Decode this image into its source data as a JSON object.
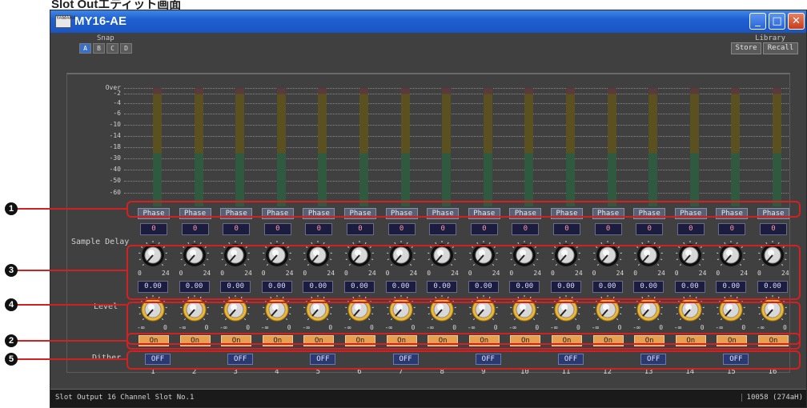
{
  "page_title": "Slot Outエディット画面",
  "window": {
    "title": "MY16-AE",
    "icon_label": "YAMAHA"
  },
  "window_controls": {
    "minimize": "_",
    "maximize": "□",
    "close": "✕"
  },
  "snap": {
    "label": "Snap",
    "buttons": [
      "A",
      "B",
      "C",
      "D"
    ],
    "active": "A"
  },
  "library": {
    "label": "Library",
    "store": "Store",
    "recall": "Recall"
  },
  "meter": {
    "scale": [
      "Over",
      "-2",
      "-4",
      "-6",
      "-10",
      "-14",
      "-18",
      "-30",
      "-40",
      "-50",
      "-60"
    ]
  },
  "labels": {
    "sample_delay": "Sample Delay",
    "level": "Level",
    "dither": "Dither"
  },
  "channels": {
    "phase": [
      "Phase",
      "Phase",
      "Phase",
      "Phase",
      "Phase",
      "Phase",
      "Phase",
      "Phase",
      "Phase",
      "Phase",
      "Phase",
      "Phase",
      "Phase",
      "Phase",
      "Phase",
      "Phase"
    ],
    "sample_delay": [
      "0",
      "0",
      "0",
      "0",
      "0",
      "0",
      "0",
      "0",
      "0",
      "0",
      "0",
      "0",
      "0",
      "0",
      "0",
      "0"
    ],
    "delay_scale_min": "0",
    "delay_scale_max": "24",
    "level": [
      "0.00",
      "0.00",
      "0.00",
      "0.00",
      "0.00",
      "0.00",
      "0.00",
      "0.00",
      "0.00",
      "0.00",
      "0.00",
      "0.00",
      "0.00",
      "0.00",
      "0.00",
      "0.00"
    ],
    "level_scale_min": "-∞",
    "level_scale_max": "0",
    "on": [
      "On",
      "On",
      "On",
      "On",
      "On",
      "On",
      "On",
      "On",
      "On",
      "On",
      "On",
      "On",
      "On",
      "On",
      "On",
      "On"
    ],
    "dither": [
      "OFF",
      "OFF",
      "OFF",
      "OFF",
      "OFF",
      "OFF",
      "OFF",
      "OFF"
    ],
    "numbers": [
      "1",
      "2",
      "3",
      "4",
      "5",
      "6",
      "7",
      "8",
      "9",
      "10",
      "11",
      "12",
      "13",
      "14",
      "15",
      "16"
    ]
  },
  "status": {
    "left": "Slot Output 16 Channel  Slot No.1",
    "right": "10058 (274aH)"
  },
  "callouts": [
    "1",
    "3",
    "4",
    "2",
    "5"
  ],
  "colors": {
    "titlebar": "#1f5fd0",
    "knob_ring_level": "#f0b830",
    "on_button": "#e8a050",
    "dither_button": "#2a3a70",
    "callout": "#d42020"
  }
}
